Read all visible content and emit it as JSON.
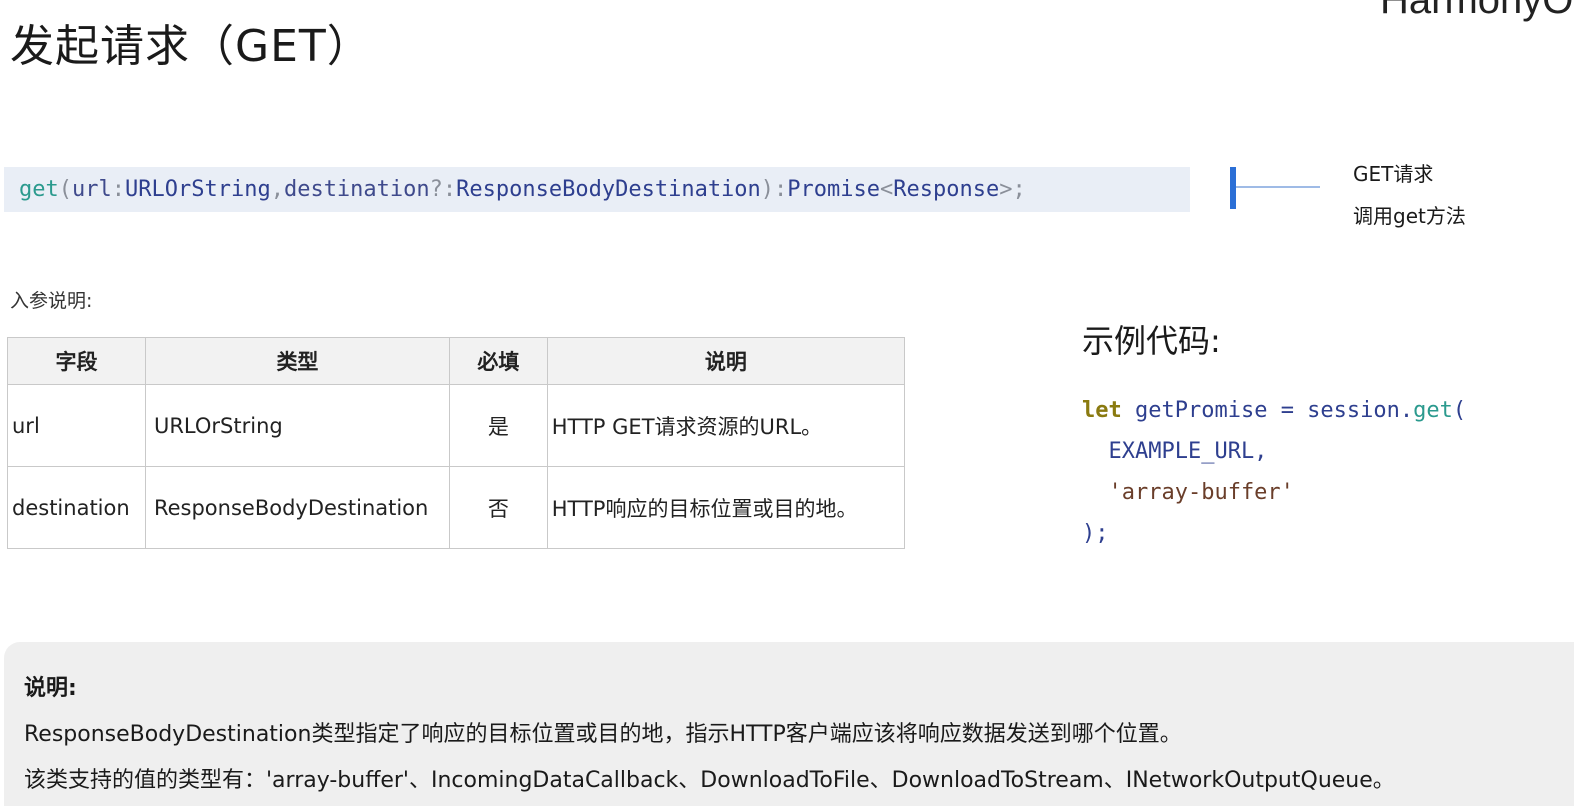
{
  "header": {
    "title": "发起请求（GET）",
    "brand": "HarmonyOS"
  },
  "signature": {
    "fn": "get",
    "open": "(",
    "param1": "url",
    "colon1": ": ",
    "type1": "URLOrString",
    "comma": ", ",
    "param2": "destination",
    "optional": "?: ",
    "type2": "ResponseBodyDestination",
    "close": "): ",
    "ret": "Promise",
    "lt": "<",
    "ret_inner": "Response",
    "gt": ">;"
  },
  "callout": {
    "title": "GET请求",
    "subtitle": "调用get方法"
  },
  "params": {
    "label": "入参说明:",
    "headers": [
      "字段",
      "类型",
      "必填",
      "说明"
    ],
    "rows": [
      [
        "url",
        "URLOrString",
        "是",
        "HTTP GET请求资源的URL。"
      ],
      [
        "destination",
        "ResponseBodyDestination",
        "否",
        "HTTP响应的目标位置或目的地。"
      ]
    ]
  },
  "example": {
    "label": "示例代码:",
    "kw": "let",
    "var": " getPromise = session.",
    "fn": "get",
    "paren": "(",
    "arg1": "  EXAMPLE_URL,",
    "arg2": "  'array-buffer'",
    "end": ");"
  },
  "note": {
    "title": "说明:",
    "line1": "ResponseBodyDestination类型指定了响应的目标位置或目的地，指示HTTP客户端应该将响应数据发送到哪个位置。",
    "line2": "该类支持的值的类型有：'array-buffer'、IncomingDataCallback、DownloadToFile、DownloadToStream、INetworkOutputQueue。"
  },
  "colors": {
    "code_background": "#e9eef6",
    "callout_accent": "#2b6fd6",
    "note_background": "#efefef"
  }
}
